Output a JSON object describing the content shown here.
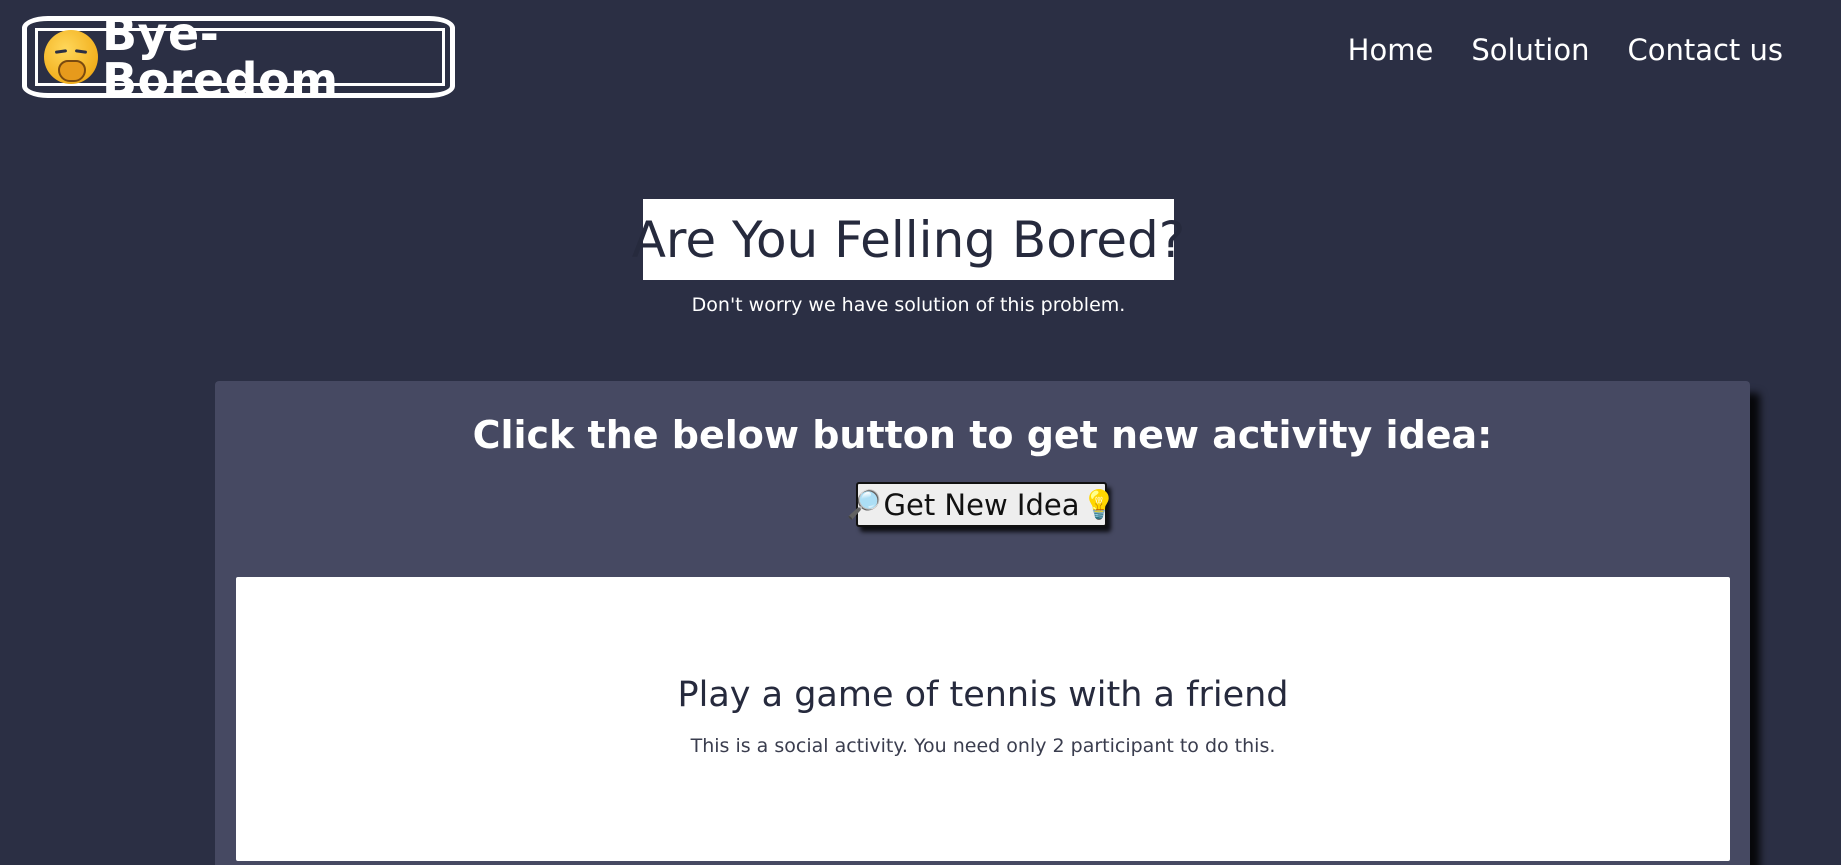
{
  "header": {
    "brand_name": "Bye-Boredom",
    "brand_icon": "yawning-face-icon",
    "nav": [
      {
        "label": "Home"
      },
      {
        "label": "Solution"
      },
      {
        "label": "Contact us"
      }
    ]
  },
  "hero": {
    "title": "Are You Felling Bored?",
    "subtitle": "Don't worry we have solution of this problem."
  },
  "activity_card": {
    "heading": "Click the below button to get new activity idea:",
    "button": {
      "label": "Get New Idea",
      "left_icon": "🔎",
      "right_icon": "💡"
    },
    "result": {
      "activity": "Play a game of tennis with a friend",
      "description": "This is a social activity. You need only 2 participant to do this."
    }
  },
  "colors": {
    "background": "#2b2f44",
    "card": "#464962",
    "text_dark": "#262a3d",
    "white": "#ffffff"
  }
}
